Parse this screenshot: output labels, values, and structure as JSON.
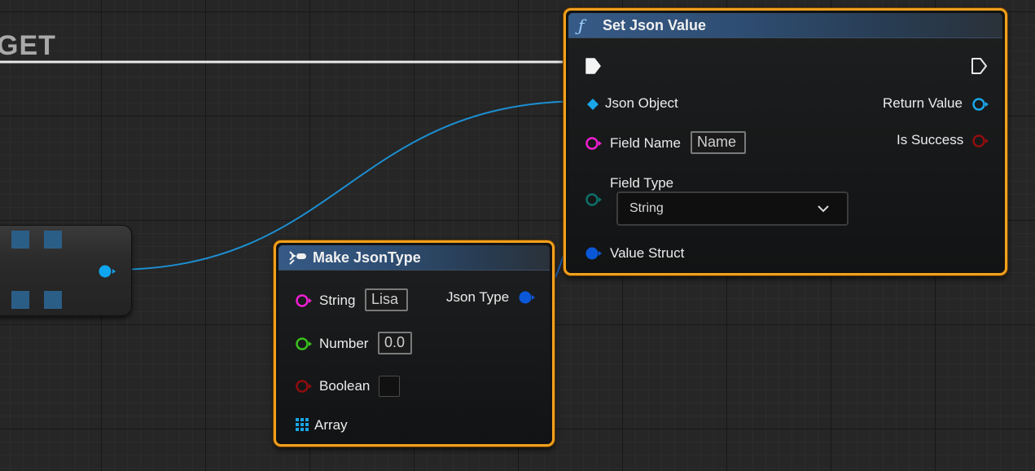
{
  "get_node": {
    "label": "GET"
  },
  "set_json_node": {
    "title": "Set Json Value",
    "inputs": {
      "json_object": "Json Object",
      "field_name": "Field Name",
      "field_name_value": "Name",
      "field_type": "Field Type",
      "field_type_value": "String",
      "value_struct": "Value Struct"
    },
    "outputs": {
      "return_value": "Return Value",
      "is_success": "Is Success"
    }
  },
  "make_json_node": {
    "title": "Make JsonType",
    "inputs": {
      "string": "String",
      "string_value": "Lisa",
      "number": "Number",
      "number_value": "0.0",
      "boolean": "Boolean",
      "array": "Array"
    },
    "outputs": {
      "json_type": "Json Type"
    }
  },
  "colors": {
    "node_border": "#f1a01d",
    "json_object_pin": "#1aa6e8",
    "string_pin": "#ee1fd2",
    "number_pin": "#39c11b",
    "boolean_pin": "#8e0e0e",
    "struct_pin": "#0a58d8",
    "byte_pin": "#0e6e6a"
  }
}
